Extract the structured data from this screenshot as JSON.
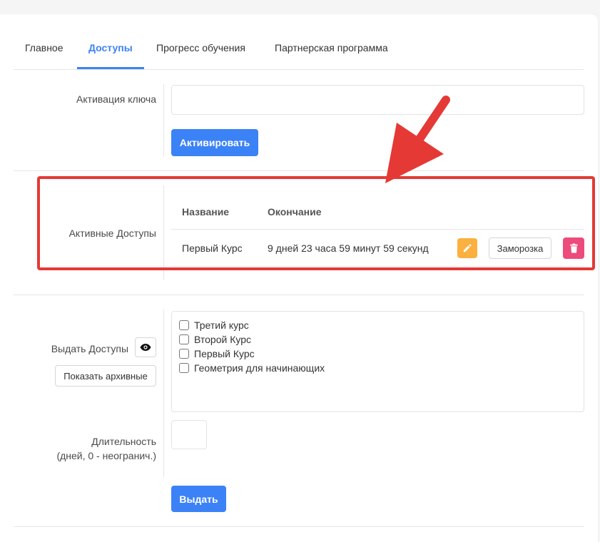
{
  "tabs": [
    {
      "label": "Главное"
    },
    {
      "label": "Доступы"
    },
    {
      "label": "Прогресс обучения"
    },
    {
      "label": "Партнерская программа"
    }
  ],
  "activation": {
    "label": "Активация ключа",
    "input_value": "",
    "button_label": "Активировать"
  },
  "active_access": {
    "label": "Активные Доступы",
    "columns": [
      "Название",
      "Окончание"
    ],
    "rows": [
      {
        "name": "Первый Курс",
        "ends": "9 дней 23 часа 59 минут 59 секунд",
        "freeze_label": "Заморозка"
      }
    ]
  },
  "grant": {
    "label": "Выдать Доступы",
    "show_archived_label": "Показать архивные",
    "courses": [
      "Третий курс",
      "Второй Курс",
      "Первый Курс",
      "Геометрия для начинающих"
    ],
    "duration_label_1": "Длительность",
    "duration_label_2": "(дней, 0 - неогранич.)",
    "duration_value": "",
    "submit_label": "Выдать"
  },
  "colors": {
    "primary": "#3b82f6",
    "edit": "#fbb040",
    "delete": "#ec4c7c",
    "highlight": "#e53935"
  },
  "icons": [
    "pencil-icon",
    "trash-icon",
    "eye-icon"
  ]
}
